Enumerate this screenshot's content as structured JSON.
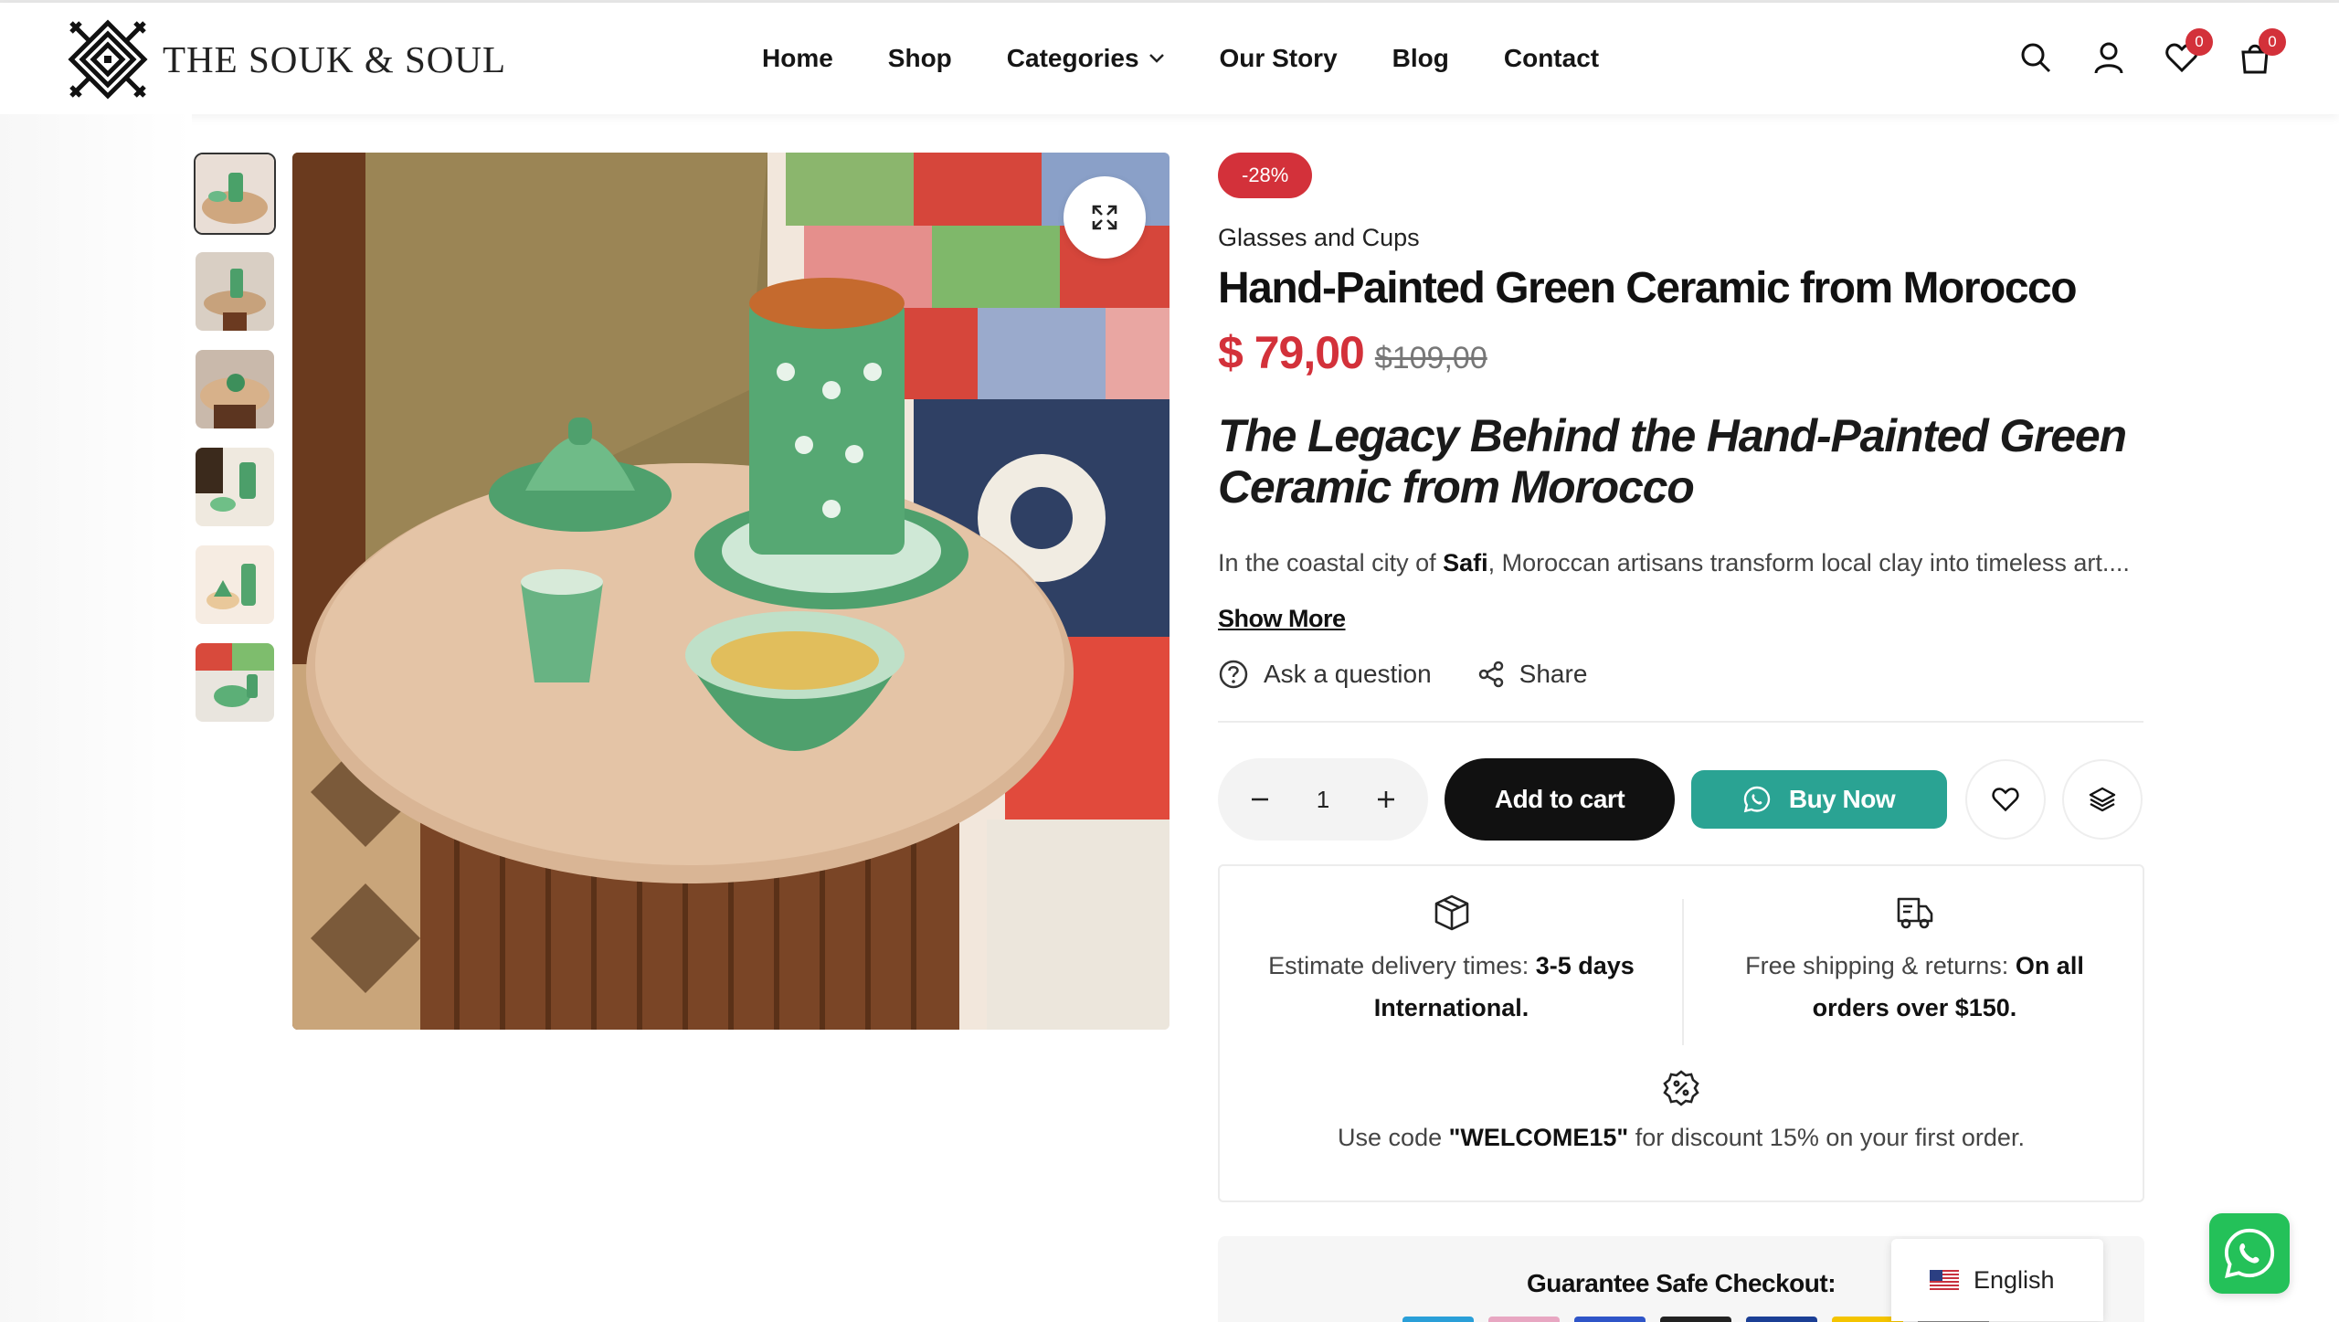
{
  "brand": {
    "name": "THE SOUK & SOUL"
  },
  "nav": {
    "items": [
      {
        "label": "Home"
      },
      {
        "label": "Shop"
      },
      {
        "label": "Categories"
      },
      {
        "label": "Our Story"
      },
      {
        "label": "Blog"
      },
      {
        "label": "Contact"
      }
    ]
  },
  "header": {
    "icons": [
      "search-icon",
      "account-icon",
      "wishlist-icon",
      "cart-icon"
    ],
    "wishlist_count": "0",
    "cart_count": "0"
  },
  "gallery": {
    "thumbnail_count": 6,
    "active_thumbnail": 1
  },
  "product": {
    "discount_badge": "-28%",
    "category": "Glasses and Cups",
    "title": "Hand-Painted Green Ceramic from Morocco",
    "price": "$ 79,00",
    "old_price": "$109,00",
    "legacy_heading": "The Legacy Behind the Hand-Painted Green Ceramic from Morocco",
    "description_prefix": "In the coastal city of ",
    "description_bold": "Safi",
    "description_suffix": ", Moroccan artisans transform local clay into timeless art....",
    "show_more": "Show More",
    "ask_question": "Ask a question",
    "share": "Share"
  },
  "cart": {
    "quantity": "1",
    "add_to_cart": "Add to cart",
    "buy_now": "Buy Now"
  },
  "info_box": {
    "delivery_prefix": "Estimate delivery times: ",
    "delivery_bold": "3-5 days International.",
    "shipping_prefix": "Free shipping & returns: ",
    "shipping_bold": "On all orders over $150.",
    "discount_prefix": "Use code ",
    "discount_code": "\"WELCOME15\"",
    "discount_suffix": " for discount 15% on your first order."
  },
  "guarantee": {
    "title": "Guarantee Safe Checkout:"
  },
  "language": {
    "label": "English"
  },
  "colors": {
    "accent_red": "#d3313a",
    "buy_now_teal": "#2aa393",
    "whatsapp_green": "#24c159"
  }
}
